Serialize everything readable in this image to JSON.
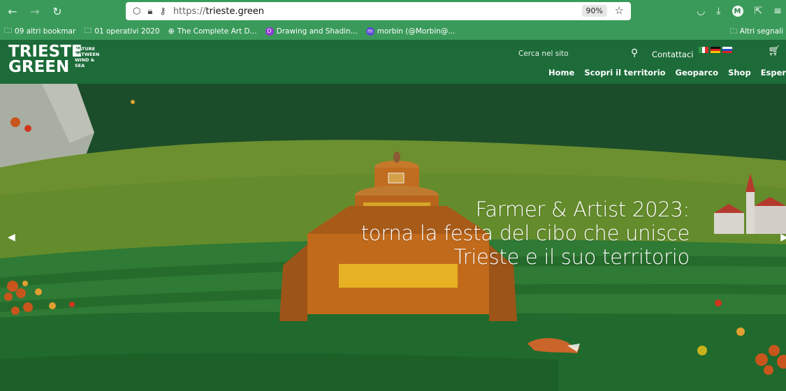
{
  "browser": {
    "url_prefix": "https://",
    "url_domain": "trieste.green",
    "zoom": "90%",
    "profile_initial": "M"
  },
  "bookmarks": {
    "items": [
      {
        "label": "09 altri bookmar",
        "icon": "folder-icon"
      },
      {
        "label": "01 operativi 2020",
        "icon": "folder-icon"
      },
      {
        "label": "The Complete Art D...",
        "icon": "globe-icon"
      },
      {
        "label": "Drawing and Shadin...",
        "icon": "drawing-badge-icon"
      },
      {
        "label": "morbin (@Morbin@...",
        "icon": "mastodon-icon"
      }
    ],
    "other_label": "Altri segnali"
  },
  "site": {
    "logo_line1": "TRIESTE",
    "logo_line2": "GREEN",
    "logo_tag": [
      "NATURE",
      "BETWEEN",
      "WIND &",
      "SEA"
    ],
    "search_placeholder": "Cerca nel sito",
    "contact_label": "Contattaci",
    "languages": [
      "it",
      "de",
      "sl"
    ],
    "nav": [
      "Home",
      "Scopri il territorio",
      "Geoparco",
      "Shop",
      "Esperien"
    ]
  },
  "hero": {
    "title_lines": [
      "Farmer & Artist 2023:",
      "torna la festa del cibo che unisce",
      "Trieste e il suo territorio"
    ]
  },
  "colors": {
    "browser_chrome": "#3a9a5a",
    "site_header": "#1c6b38",
    "hero_sky": "#1a4a28"
  }
}
